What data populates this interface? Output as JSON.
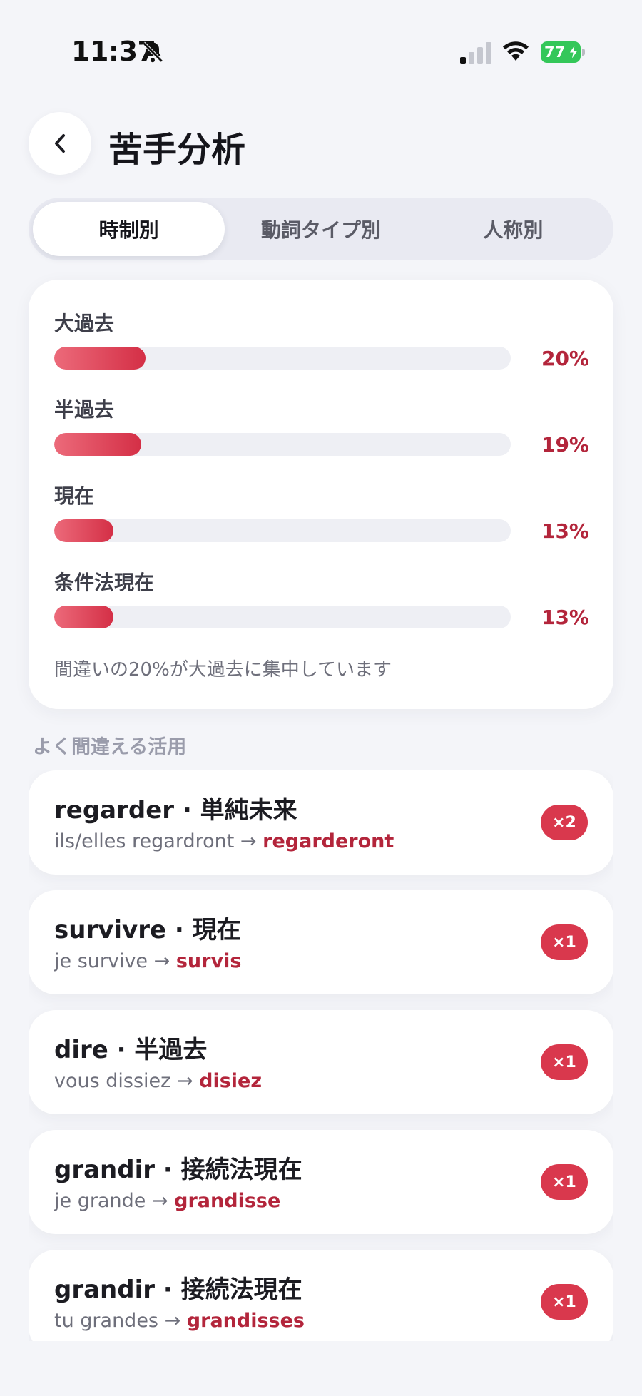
{
  "status_bar": {
    "time": "11:37",
    "battery": "77"
  },
  "header": {
    "title": "苦手分析"
  },
  "tabs": [
    {
      "label": "時制別",
      "active": true
    },
    {
      "label": "動詞タイプ別",
      "active": false
    },
    {
      "label": "人称別",
      "active": false
    }
  ],
  "stats": {
    "rows": [
      {
        "label": "大過去",
        "percent_text": "20%",
        "percent": 20
      },
      {
        "label": "半過去",
        "percent_text": "19%",
        "percent": 19
      },
      {
        "label": "現在",
        "percent_text": "13%",
        "percent": 13
      },
      {
        "label": "条件法現在",
        "percent_text": "13%",
        "percent": 13
      }
    ],
    "note": "間違いの20%が大過去に集中しています"
  },
  "section_label": "よく間違える活用",
  "mistakes": [
    {
      "title": "regarder · 単純未来",
      "prompt": "ils/elles regardront →",
      "answer": "regarderont",
      "count": "×2"
    },
    {
      "title": "survivre · 現在",
      "prompt": "je survive →",
      "answer": "survis",
      "count": "×1"
    },
    {
      "title": "dire · 半過去",
      "prompt": "vous dissiez →",
      "answer": "disiez",
      "count": "×1"
    },
    {
      "title": "grandir · 接続法現在",
      "prompt": "je grande →",
      "answer": "grandisse",
      "count": "×1"
    },
    {
      "title": "grandir · 接続法現在",
      "prompt": "tu grandes →",
      "answer": "grandisses",
      "count": "×1"
    }
  ],
  "icons": {
    "back": "chevron-left-icon",
    "bell": "bell-slash-icon",
    "signal": "cellular-signal-icon",
    "wifi": "wifi-icon",
    "battery": "battery-charging-icon"
  },
  "colors": {
    "accent": "#d9384d",
    "accent_text": "#b3253b",
    "background": "#f4f5f9",
    "battery": "#34c759"
  }
}
